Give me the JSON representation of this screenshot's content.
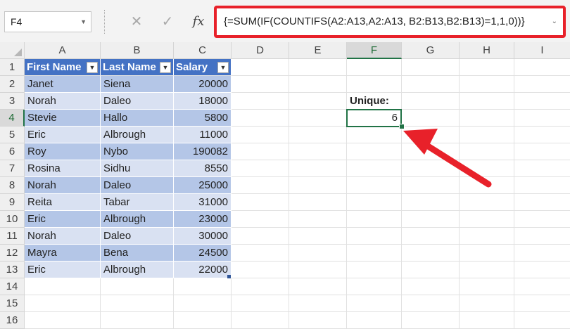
{
  "name_box": {
    "value": "F4"
  },
  "formula_bar": {
    "cancel_icon": "close-icon",
    "enter_icon": "checkmark-icon",
    "fx_label": "fx",
    "formula": "{=SUM(IF(COUNTIFS(A2:A13,A2:A13, B2:B13,B2:B13)=1,1,0))}",
    "highlight_color": "#e8212a"
  },
  "columns": [
    "A",
    "B",
    "C",
    "D",
    "E",
    "F",
    "G",
    "H",
    "I"
  ],
  "rows": [
    "1",
    "2",
    "3",
    "4",
    "5",
    "6",
    "7",
    "8",
    "9",
    "10",
    "11",
    "12",
    "13",
    "14",
    "15",
    "16"
  ],
  "active_column": "F",
  "active_row": "4",
  "table": {
    "headers": [
      "First Name",
      "Last Name",
      "Salary"
    ],
    "dropdown_icon": "dropdown-arrow-icon",
    "header_color": "#4472c4",
    "band_colors": [
      "#b4c6e7",
      "#d9e1f2"
    ],
    "rows": [
      [
        "Janet",
        "Siena",
        "20000"
      ],
      [
        "Norah",
        "Daleo",
        "18000"
      ],
      [
        "Stevie",
        "Hallo",
        "5800"
      ],
      [
        "Eric",
        "Albrough",
        "11000"
      ],
      [
        "Roy",
        "Nybo",
        "190082"
      ],
      [
        "Rosina",
        "Sidhu",
        "8550"
      ],
      [
        "Norah",
        "Daleo",
        "25000"
      ],
      [
        "Reita",
        "Tabar",
        "31000"
      ],
      [
        "Eric",
        "Albrough",
        "23000"
      ],
      [
        "Norah",
        "Daleo",
        "30000"
      ],
      [
        "Mayra",
        "Bena",
        "24500"
      ],
      [
        "Eric",
        "Albrough",
        "22000"
      ]
    ]
  },
  "unique": {
    "label": "Unique:",
    "value": "6"
  },
  "annotation": {
    "arrow_icon": "red-arrow-icon",
    "color": "#e8212a"
  }
}
